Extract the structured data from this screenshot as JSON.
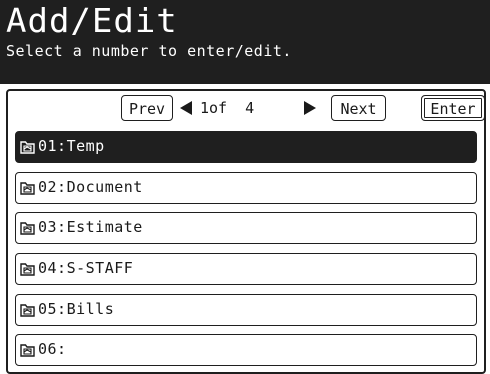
{
  "header": {
    "title": "Add/Edit",
    "subtitle": "Select a number to enter/edit."
  },
  "nav": {
    "prev_label": "Prev",
    "next_label": "Next",
    "enter_label": "Enter",
    "page_info": "1of  4"
  },
  "list": {
    "items": [
      {
        "label": "01:Temp",
        "icon": "folder-icon",
        "selected": true
      },
      {
        "label": "02:Document",
        "icon": "folder-icon",
        "selected": false
      },
      {
        "label": "03:Estimate",
        "icon": "folder-icon",
        "selected": false
      },
      {
        "label": "04:S-STAFF",
        "icon": "folder-icon",
        "selected": false
      },
      {
        "label": "05:Bills",
        "icon": "folder-icon",
        "selected": false
      },
      {
        "label": "06:",
        "icon": "folder-icon",
        "selected": false
      }
    ]
  },
  "colors": {
    "dark": "#1f1f1f",
    "light": "#ffffff"
  }
}
